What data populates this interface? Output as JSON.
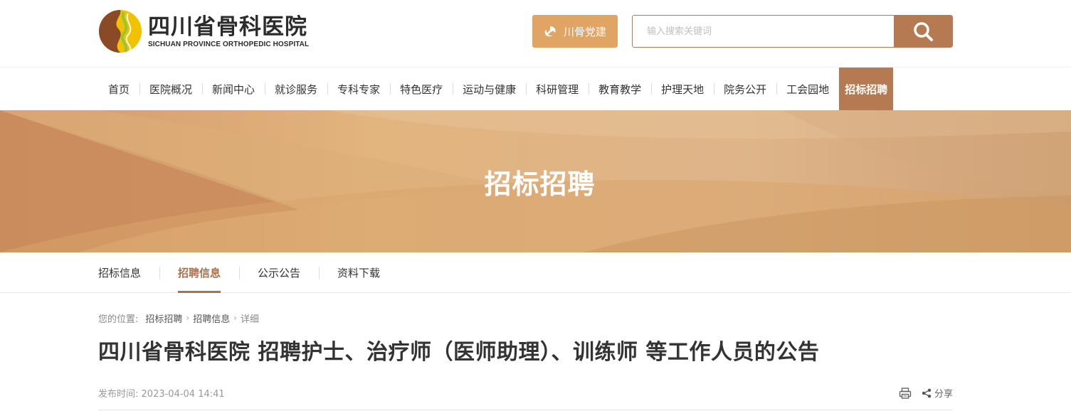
{
  "header": {
    "logo_cn": "四川省骨科医院",
    "logo_en": "SICHUAN PROVINCE ORTHOPEDIC HOSPITAL",
    "party_button": "川骨党建",
    "search_placeholder": "输入搜索关键词"
  },
  "nav": {
    "items": [
      {
        "label": "首页"
      },
      {
        "label": "医院概况"
      },
      {
        "label": "新闻中心"
      },
      {
        "label": "就诊服务"
      },
      {
        "label": "专科专家"
      },
      {
        "label": "特色医疗"
      },
      {
        "label": "运动与健康"
      },
      {
        "label": "科研管理"
      },
      {
        "label": "教育教学"
      },
      {
        "label": "护理天地"
      },
      {
        "label": "院务公开"
      },
      {
        "label": "工会园地"
      },
      {
        "label": "招标招聘"
      }
    ],
    "active_index": 12
  },
  "banner": {
    "title": "招标招聘"
  },
  "subnav": {
    "items": [
      {
        "label": "招标信息"
      },
      {
        "label": "招聘信息"
      },
      {
        "label": "公示公告"
      },
      {
        "label": "资料下载"
      }
    ],
    "active_index": 1
  },
  "breadcrumb": {
    "prefix": "您的位置:",
    "level1": "招标招聘",
    "level2": "招聘信息",
    "current": "详细"
  },
  "article": {
    "title": "四川省骨科医院 招聘护士、治疗师（医师助理）、训练师 等工作人员的公告",
    "publish_label": "发布时间:",
    "publish_time": "2023-04-04 14:41",
    "share_label": "分享"
  },
  "colors": {
    "brand": "#b57a52",
    "party_button": "#e0a464",
    "banner_light": "#e2b47e",
    "banner_dark": "#c98e5e"
  }
}
